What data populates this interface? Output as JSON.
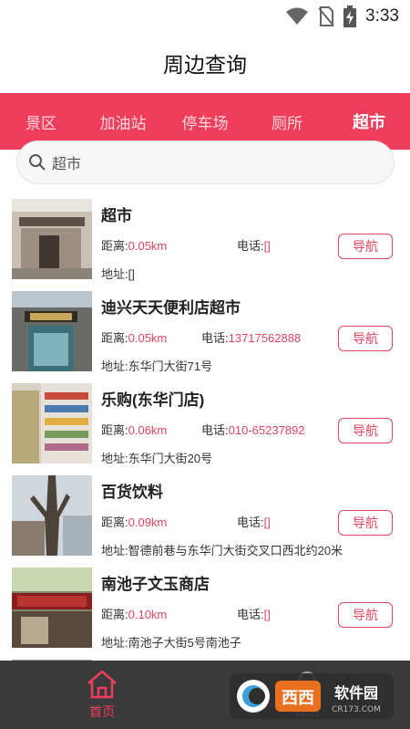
{
  "status_bar": {
    "time": "3:33",
    "icons": [
      "wifi-icon",
      "no-sim-icon",
      "battery-charging-icon"
    ]
  },
  "header": {
    "title": "周边查询"
  },
  "tabs": [
    {
      "label": "景区",
      "active": false
    },
    {
      "label": "加油站",
      "active": false
    },
    {
      "label": "停车场",
      "active": false
    },
    {
      "label": "厕所",
      "active": false
    },
    {
      "label": "超市",
      "active": true
    }
  ],
  "search": {
    "value": "超市",
    "icon": "search-icon"
  },
  "results": [
    {
      "name": "超市",
      "distance_label": "距离:",
      "distance": "0.05km",
      "phone_label": "电话:",
      "phone": "[]",
      "address_label": "地址:",
      "address": "[]",
      "nav_label": "导航"
    },
    {
      "name": "迪兴天天便利店超市",
      "distance_label": "距离:",
      "distance": "0.05km",
      "phone_label": "电话:",
      "phone": "13717562888",
      "address_label": "地址:",
      "address": "东华门大街71号",
      "nav_label": "导航"
    },
    {
      "name": "乐购(东华门店)",
      "distance_label": "距离:",
      "distance": "0.06km",
      "phone_label": "电话:",
      "phone": "010-65237892",
      "address_label": "地址:",
      "address": "东华门大街20号",
      "nav_label": "导航"
    },
    {
      "name": "百货饮料",
      "distance_label": "距离:",
      "distance": "0.09km",
      "phone_label": "电话:",
      "phone": "[]",
      "address_label": "地址:",
      "address": "智德前巷与东华门大街交叉口西北约20米",
      "nav_label": "导航"
    },
    {
      "name": "南池子文玉商店",
      "distance_label": "距离:",
      "distance": "0.10km",
      "phone_label": "电话:",
      "phone": "[]",
      "address_label": "地址:",
      "address": "南池子大街5号南池子",
      "nav_label": "导航"
    }
  ],
  "bottom_nav": {
    "home_label": "首页",
    "mine_label": "我的"
  },
  "watermark": {
    "brand": "西西软件园",
    "site": "CR173.COM"
  },
  "colors": {
    "accent": "#ef3e5c",
    "price_red": "#e2455f",
    "nav_bg": "#3a3a3a"
  }
}
